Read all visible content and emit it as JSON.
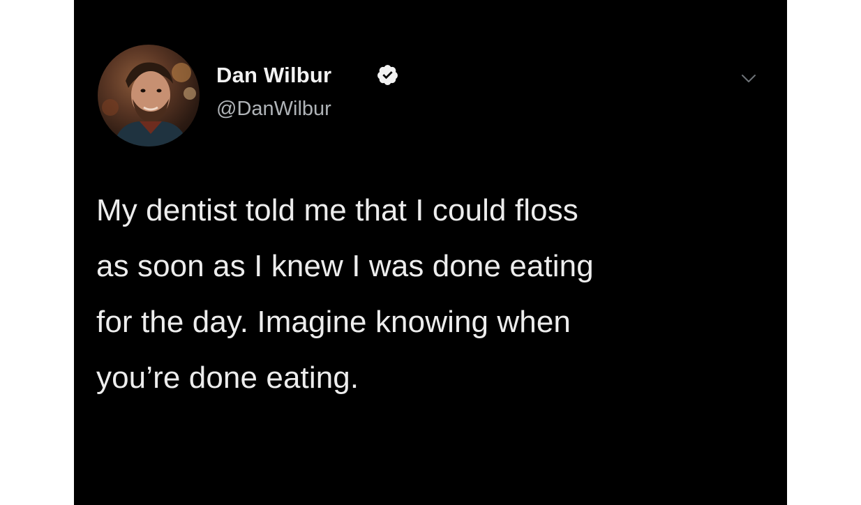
{
  "tweet": {
    "author": {
      "display_name": "Dan Wilbur",
      "handle": "@DanWilbur",
      "verified": true,
      "avatar_icon": "profile-photo"
    },
    "menu_icon": "chevron-down-icon",
    "text_lines": [
      "My dentist told me that I could floss",
      "as soon as I knew I was done eating",
      "for the day. Imagine knowing when",
      "you’re done eating."
    ]
  },
  "colors": {
    "background": "#000000",
    "page_margin": "#ffffff",
    "text": "#e7e9ea",
    "handle": "#b0b4b8"
  }
}
